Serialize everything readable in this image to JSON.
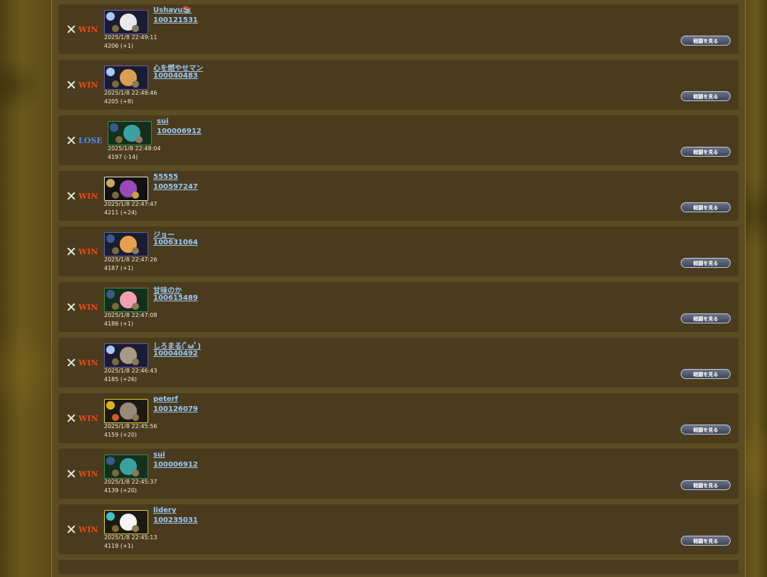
{
  "battles": [
    {
      "result": "WIN",
      "name": "Ushayu📚",
      "uid": "100121531",
      "time": "2025/1/8 22:49:11",
      "rating": "4206 (+1)",
      "button": "戦闘を見る"
    },
    {
      "result": "WIN",
      "name": "心を燃やせマン",
      "uid": "100040483",
      "time": "2025/1/8 22:48:46",
      "rating": "4205 (+8)",
      "button": "戦闘を見る"
    },
    {
      "result": "LOSE",
      "name": "sui",
      "uid": "100006912",
      "time": "2025/1/8 22:48:04",
      "rating": "4197 (-14)",
      "button": "戦闘を見る"
    },
    {
      "result": "WIN",
      "name": "55555",
      "uid": "100597247",
      "time": "2025/1/8 22:47:47",
      "rating": "4211 (+24)",
      "button": "戦闘を見る"
    },
    {
      "result": "WIN",
      "name": "ジョー",
      "uid": "100631064",
      "time": "2025/1/8 22:47:26",
      "rating": "4187 (+1)",
      "button": "戦闘を見る"
    },
    {
      "result": "WIN",
      "name": "甘味のか",
      "uid": "100615489",
      "time": "2025/1/8 22:47:08",
      "rating": "4186 (+1)",
      "button": "戦闘を見る"
    },
    {
      "result": "WIN",
      "name": "しろまる(ﾟωﾟ)",
      "uid": "100040492",
      "time": "2025/1/8 22:46:43",
      "rating": "4185 (+26)",
      "button": "戦闘を見る"
    },
    {
      "result": "WIN",
      "name": "peterf",
      "uid": "100126079",
      "time": "2025/1/8 22:45:56",
      "rating": "4159 (+20)",
      "button": "戦闘を見る"
    },
    {
      "result": "WIN",
      "name": "sui",
      "uid": "100006912",
      "time": "2025/1/8 22:45:37",
      "rating": "4139 (+20)",
      "button": "戦闘を見る"
    },
    {
      "result": "WIN",
      "name": "lidery",
      "uid": "100235031",
      "time": "2025/1/8 22:45:13",
      "rating": "4119 (+1)",
      "button": "戦闘を見る"
    }
  ],
  "colors": {
    "win": "#e8481c",
    "lose": "#4a8cf0",
    "link": "#9cc8f4",
    "row": "#4a3b1e"
  },
  "icons": {
    "result": "crossed-swords-icon",
    "deck": "deck-thumbnail-icon"
  }
}
